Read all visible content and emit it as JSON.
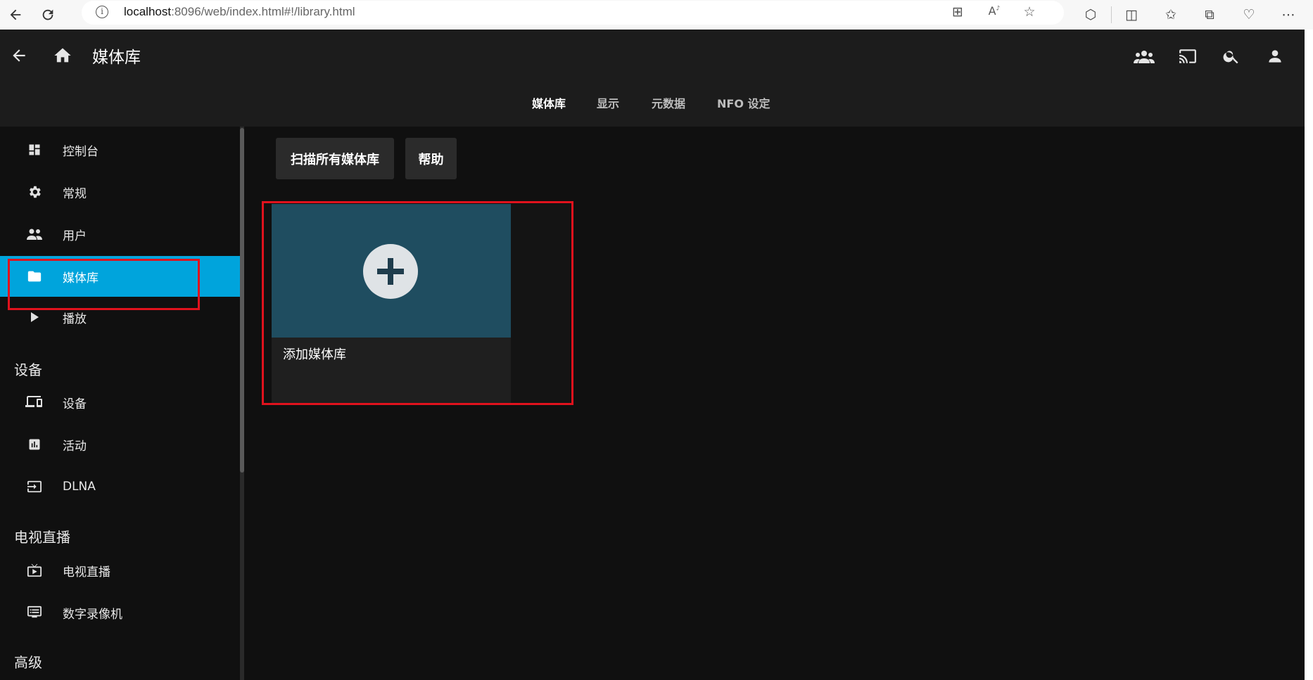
{
  "browser": {
    "url_host": "localhost",
    "url_rest": ":8096/web/index.html#!/library.html"
  },
  "header": {
    "title": "媒体库",
    "tabs": [
      {
        "label": "媒体库",
        "active": true
      },
      {
        "label": "显示",
        "active": false
      },
      {
        "label": "元数据",
        "active": false
      },
      {
        "label": "NFO 设定",
        "active": false
      }
    ]
  },
  "sidebar": {
    "items": [
      {
        "label": "控制台",
        "icon": "dashboard-icon"
      },
      {
        "label": "常规",
        "icon": "gear-icon"
      },
      {
        "label": "用户",
        "icon": "people-icon"
      },
      {
        "label": "媒体库",
        "icon": "folder-icon",
        "active": true
      },
      {
        "label": "播放",
        "icon": "play-icon"
      }
    ],
    "section_devices": "设备",
    "devices_items": [
      {
        "label": "设备",
        "icon": "devices-icon"
      },
      {
        "label": "活动",
        "icon": "chart-icon"
      },
      {
        "label": "DLNA",
        "icon": "input-icon"
      }
    ],
    "section_livetv": "电视直播",
    "livetv_items": [
      {
        "label": "电视直播",
        "icon": "tv-icon"
      },
      {
        "label": "数字录像机",
        "icon": "dvr-icon"
      }
    ],
    "section_advanced": "高级"
  },
  "content": {
    "scan_button": "扫描所有媒体库",
    "help_button": "帮助",
    "add_library_label": "添加媒体库"
  },
  "colors": {
    "accent": "#00a4dc",
    "highlight_red": "#e0121d",
    "card_thumb": "#1f4d60"
  }
}
